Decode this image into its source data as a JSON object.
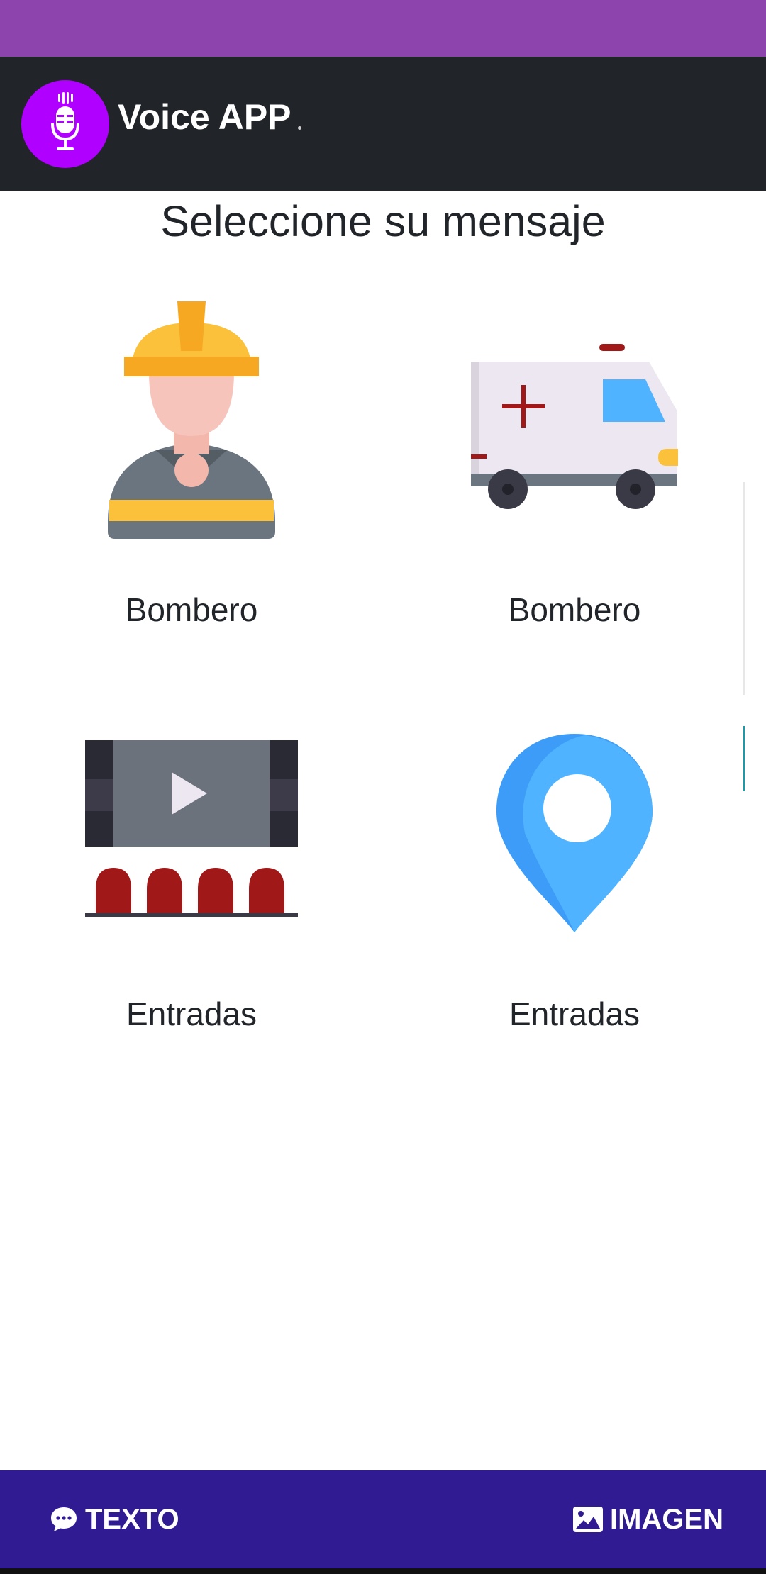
{
  "app": {
    "title": "Voice APP",
    "logo_icon": "microphone-icon",
    "colors": {
      "status_bar": "#8e44ad",
      "app_bar": "#212529",
      "logo": "#b000ff",
      "bottom_bar": "#311b92"
    }
  },
  "page": {
    "heading": "Seleccione su mensaje"
  },
  "cards": [
    {
      "label": "Bombero",
      "icon": "firefighter-icon"
    },
    {
      "label": "Bombero",
      "icon": "ambulance-icon"
    },
    {
      "label": "Entradas",
      "icon": "cinema-tickets-icon"
    },
    {
      "label": "Entradas",
      "icon": "location-pin-icon"
    }
  ],
  "bottom_nav": {
    "text_label": "TEXTO",
    "text_icon": "chat-bubble-icon",
    "image_label": "IMAGEN",
    "image_icon": "image-icon"
  }
}
